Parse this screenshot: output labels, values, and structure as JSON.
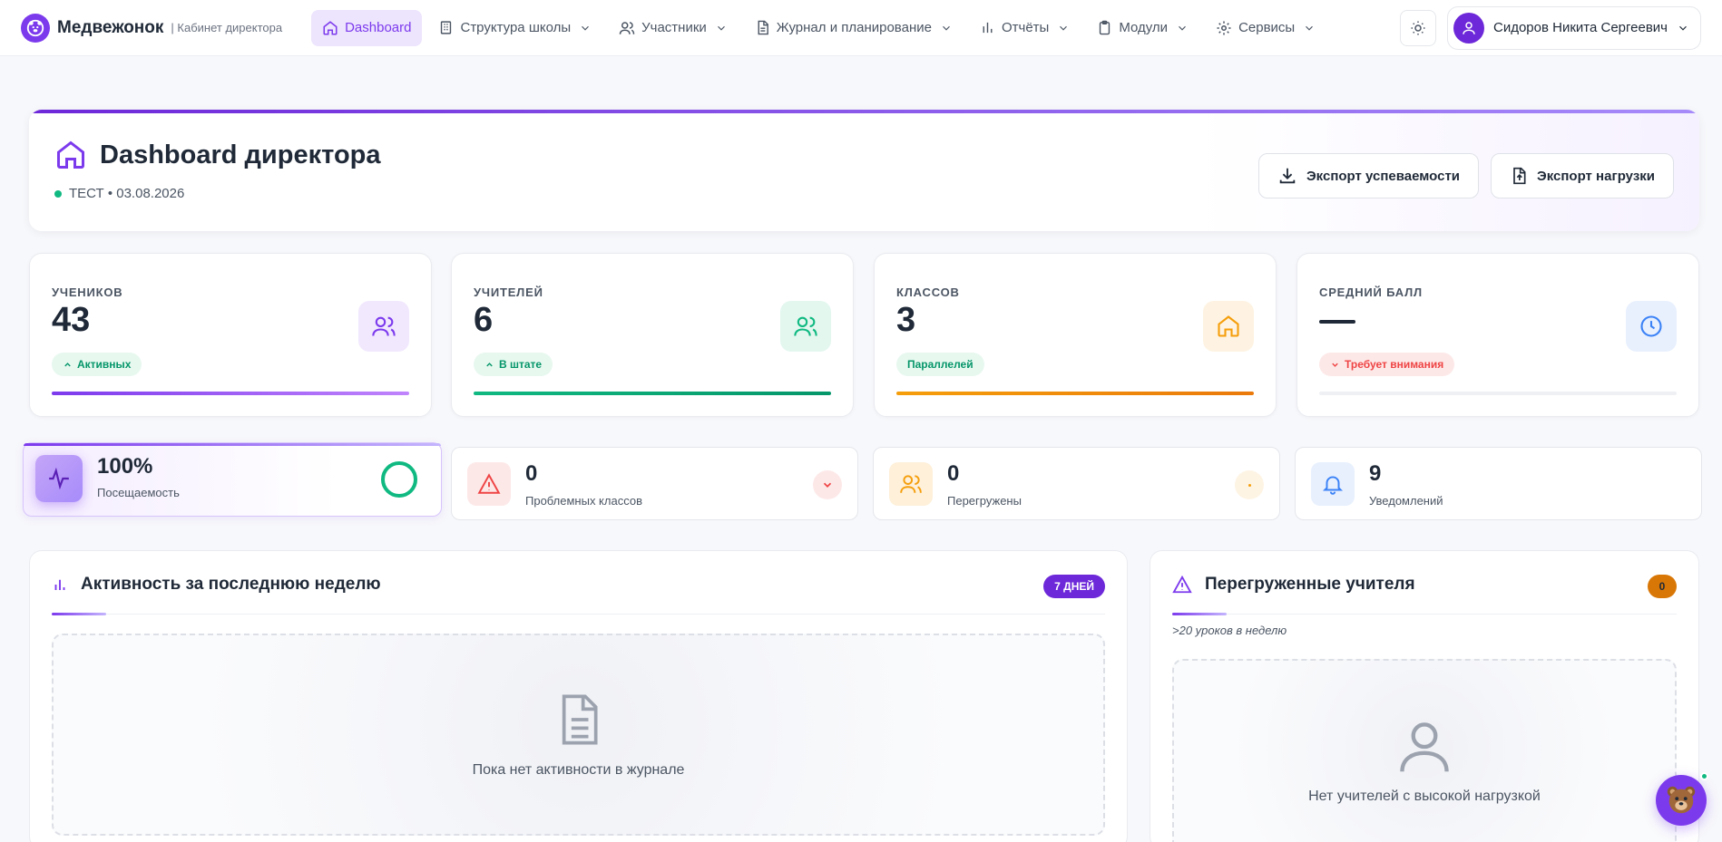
{
  "brand": {
    "name": "Медвежонок",
    "subtitle": "| Кабинет директора"
  },
  "nav": {
    "items": [
      {
        "label": "Dashboard",
        "icon": "home-icon",
        "active": true
      },
      {
        "label": "Структура школы",
        "icon": "building-icon"
      },
      {
        "label": "Участники",
        "icon": "users-icon"
      },
      {
        "label": "Журнал и планирование",
        "icon": "document-icon"
      },
      {
        "label": "Отчёты",
        "icon": "bar-chart-icon"
      },
      {
        "label": "Модули",
        "icon": "clipboard-icon"
      },
      {
        "label": "Сервисы",
        "icon": "gear-icon"
      }
    ],
    "user_name": "Сидоров Никита Сергеевич"
  },
  "header": {
    "title": "Dashboard директора",
    "status": "ТЕСТ • 03.08.2026",
    "export_grades_label": "Экспорт успеваемости",
    "export_load_label": "Экспорт нагрузки"
  },
  "stats": [
    {
      "label": "УЧЕНИКОВ",
      "value": "43",
      "badge": "Активных",
      "color": "#7c3aed"
    },
    {
      "label": "УЧИТЕЛЕЙ",
      "value": "6",
      "badge": "В штате",
      "color": "#10b981"
    },
    {
      "label": "КЛАССОВ",
      "value": "3",
      "badge": "Параллелей",
      "color": "#f59e0b"
    },
    {
      "label": "СРЕДНИЙ БАЛЛ",
      "value": "",
      "badge": "Требует внимания",
      "color": "#ef4444"
    }
  ],
  "mini": [
    {
      "value": "100%",
      "label": "Посещаемость",
      "progress": 1.0
    },
    {
      "value": "0",
      "label": "Проблемных классов"
    },
    {
      "value": "0",
      "label": "Перегружены"
    },
    {
      "value": "9",
      "label": "Уведомлений"
    }
  ],
  "activity": {
    "title": "Активность за последнюю неделю",
    "pill": "7 ДНЕЙ",
    "empty": "Пока нет активности в журнале"
  },
  "overloaded": {
    "title": "Перегруженные учителя",
    "count": "0",
    "note": ">20 уроков в неделю",
    "empty": "Нет учителей с высокой нагрузкой"
  },
  "colors": {
    "accent": "#7c3aed",
    "green": "#10b981",
    "amber": "#f59e0b",
    "red": "#ef4444",
    "blue": "#3b82f6"
  }
}
